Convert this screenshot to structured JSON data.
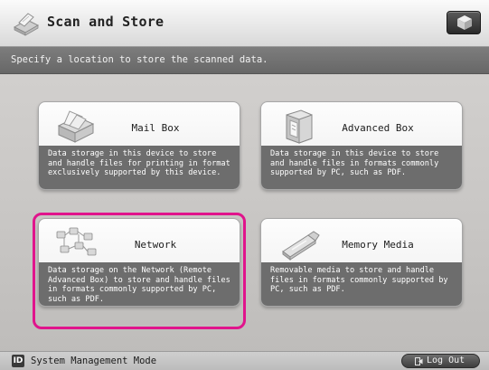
{
  "header": {
    "title": "Scan and Store",
    "app_icon": "scanner-icon",
    "top_right_button_icon": "cube-icon"
  },
  "instruction": "Specify a location to store the scanned data.",
  "options": [
    {
      "title": "Mail Box",
      "icon": "mailbox-icon",
      "description": "Data storage in this device to store and handle files for printing in format exclusively supported by this device.",
      "selected": false
    },
    {
      "title": "Advanced Box",
      "icon": "advanced-box-icon",
      "description": "Data storage in this device to store and handle files in formats commonly supported by PC, such as PDF.",
      "selected": false
    },
    {
      "title": "Network",
      "icon": "network-icon",
      "description": "Data storage on the Network (Remote Advanced Box) to store and handle files in formats commonly supported by PC, such as PDF.",
      "selected": true
    },
    {
      "title": "Memory Media",
      "icon": "usb-memory-icon",
      "description": "Removable media to store and handle files in formats commonly supported by PC, such as PDF.",
      "selected": false
    }
  ],
  "statusbar": {
    "mode_icon_text": "ID",
    "mode_label": "System Management Mode",
    "logout_label": "Log Out"
  },
  "colors": {
    "selection_border": "#e0148c",
    "description_bg": "#6d6d6d",
    "instruction_bg": "#737373"
  }
}
